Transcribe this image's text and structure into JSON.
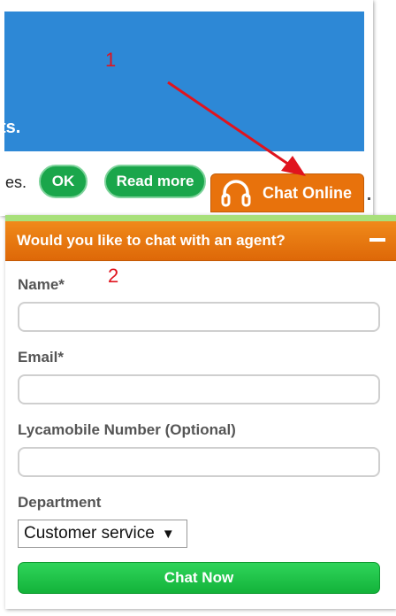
{
  "annotations": {
    "step1": "1",
    "step2": "2",
    "arrow_color": "#e0141e"
  },
  "panel1": {
    "banner_tail_text": "ts.",
    "cookie_tail_text": "es.",
    "ok_label": "OK",
    "read_more_label": "Read more",
    "chat_online_label": "Chat Online",
    "chat_online_icon": "headphones-icon",
    "accent_orange": "#e8720c",
    "accent_green": "#1aa64b",
    "banner_blue": "#2d88d6"
  },
  "panel2": {
    "header_title": "Would you like to chat with an agent?",
    "minimize_icon": "minus-icon",
    "fields": {
      "name": {
        "label": "Name*",
        "value": ""
      },
      "email": {
        "label": "Email*",
        "value": ""
      },
      "lyca_number": {
        "label": "Lycamobile Number (Optional)",
        "value": ""
      }
    },
    "department": {
      "label": "Department",
      "selected": "Customer service",
      "caret": "▼"
    },
    "chat_now_label": "Chat Now"
  }
}
